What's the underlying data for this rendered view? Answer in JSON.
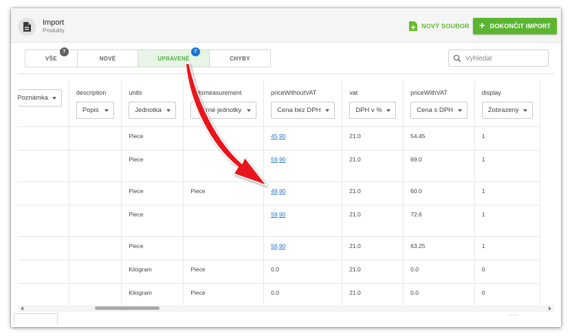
{
  "header": {
    "title": "Import",
    "subtitle": "Produkty",
    "new_file_label": "NOVÝ SOUBOR",
    "finish_label": "DOKONČIT IMPORT"
  },
  "tabs": [
    {
      "label": "VŠE",
      "badge": "7",
      "active": false
    },
    {
      "label": "NOVÉ",
      "active": false
    },
    {
      "label": "UPRAVENÉ",
      "badge": "7",
      "active": true
    },
    {
      "label": "CHYBY",
      "active": false
    }
  ],
  "search": {
    "placeholder": "Vyhledat"
  },
  "table": {
    "columns": [
      {
        "name": "",
        "select": "Poznámka"
      },
      {
        "name": "description",
        "select": "Popis"
      },
      {
        "name": "units",
        "select": "Jednotka"
      },
      {
        "name": "unitsmeasurement",
        "select": "Měrné jednotky"
      },
      {
        "name": "priceWithoutVAT",
        "select": "Cena bez DPH"
      },
      {
        "name": "vat",
        "select": "DPH v %"
      },
      {
        "name": "priceWithVAT",
        "select": "Cena s DPH"
      },
      {
        "name": "display",
        "select": "Zobrazený"
      }
    ],
    "rows": [
      {
        "units": "Piece",
        "unitsmeasurement": "",
        "priceWithoutVAT": "45,90",
        "vat": "21.0",
        "priceWithVAT": "54.45",
        "display": "1"
      },
      {
        "units": "Piece",
        "unitsmeasurement": "",
        "priceWithoutVAT": "59,90",
        "vat": "21.0",
        "priceWithVAT": "69.0",
        "display": "1"
      },
      {
        "units": "Piece",
        "unitsmeasurement": "Piece",
        "priceWithoutVAT": "49,90",
        "vat": "21.0",
        "priceWithVAT": "60.0",
        "display": "1"
      },
      {
        "units": "Piece",
        "unitsmeasurement": "",
        "priceWithoutVAT": "59,90",
        "vat": "21.0",
        "priceWithVAT": "72.6",
        "display": "1"
      },
      {
        "units": "Piece",
        "unitsmeasurement": "",
        "priceWithoutVAT": "56,90",
        "vat": "21.0",
        "priceWithVAT": "63.25",
        "display": "1"
      },
      {
        "units": "Kilogram",
        "unitsmeasurement": "Piece",
        "priceWithoutVAT": "0.0",
        "vat": "21.0",
        "priceWithVAT": "0.0",
        "display": "0"
      },
      {
        "units": "Kilogram",
        "unitsmeasurement": "Piece",
        "priceWithoutVAT": "0.0",
        "vat": "21.0",
        "priceWithVAT": "0.0",
        "display": "0"
      }
    ]
  },
  "colors": {
    "accent_green": "#5cb531",
    "link_blue": "#1e73c8",
    "badge_blue": "#1976d2",
    "annotation_arrow": "#e8141a"
  },
  "icons": [
    "document-icon",
    "new-file-icon",
    "plus-icon",
    "search-icon",
    "chevron-down-icon",
    "annotation-arrow"
  ]
}
